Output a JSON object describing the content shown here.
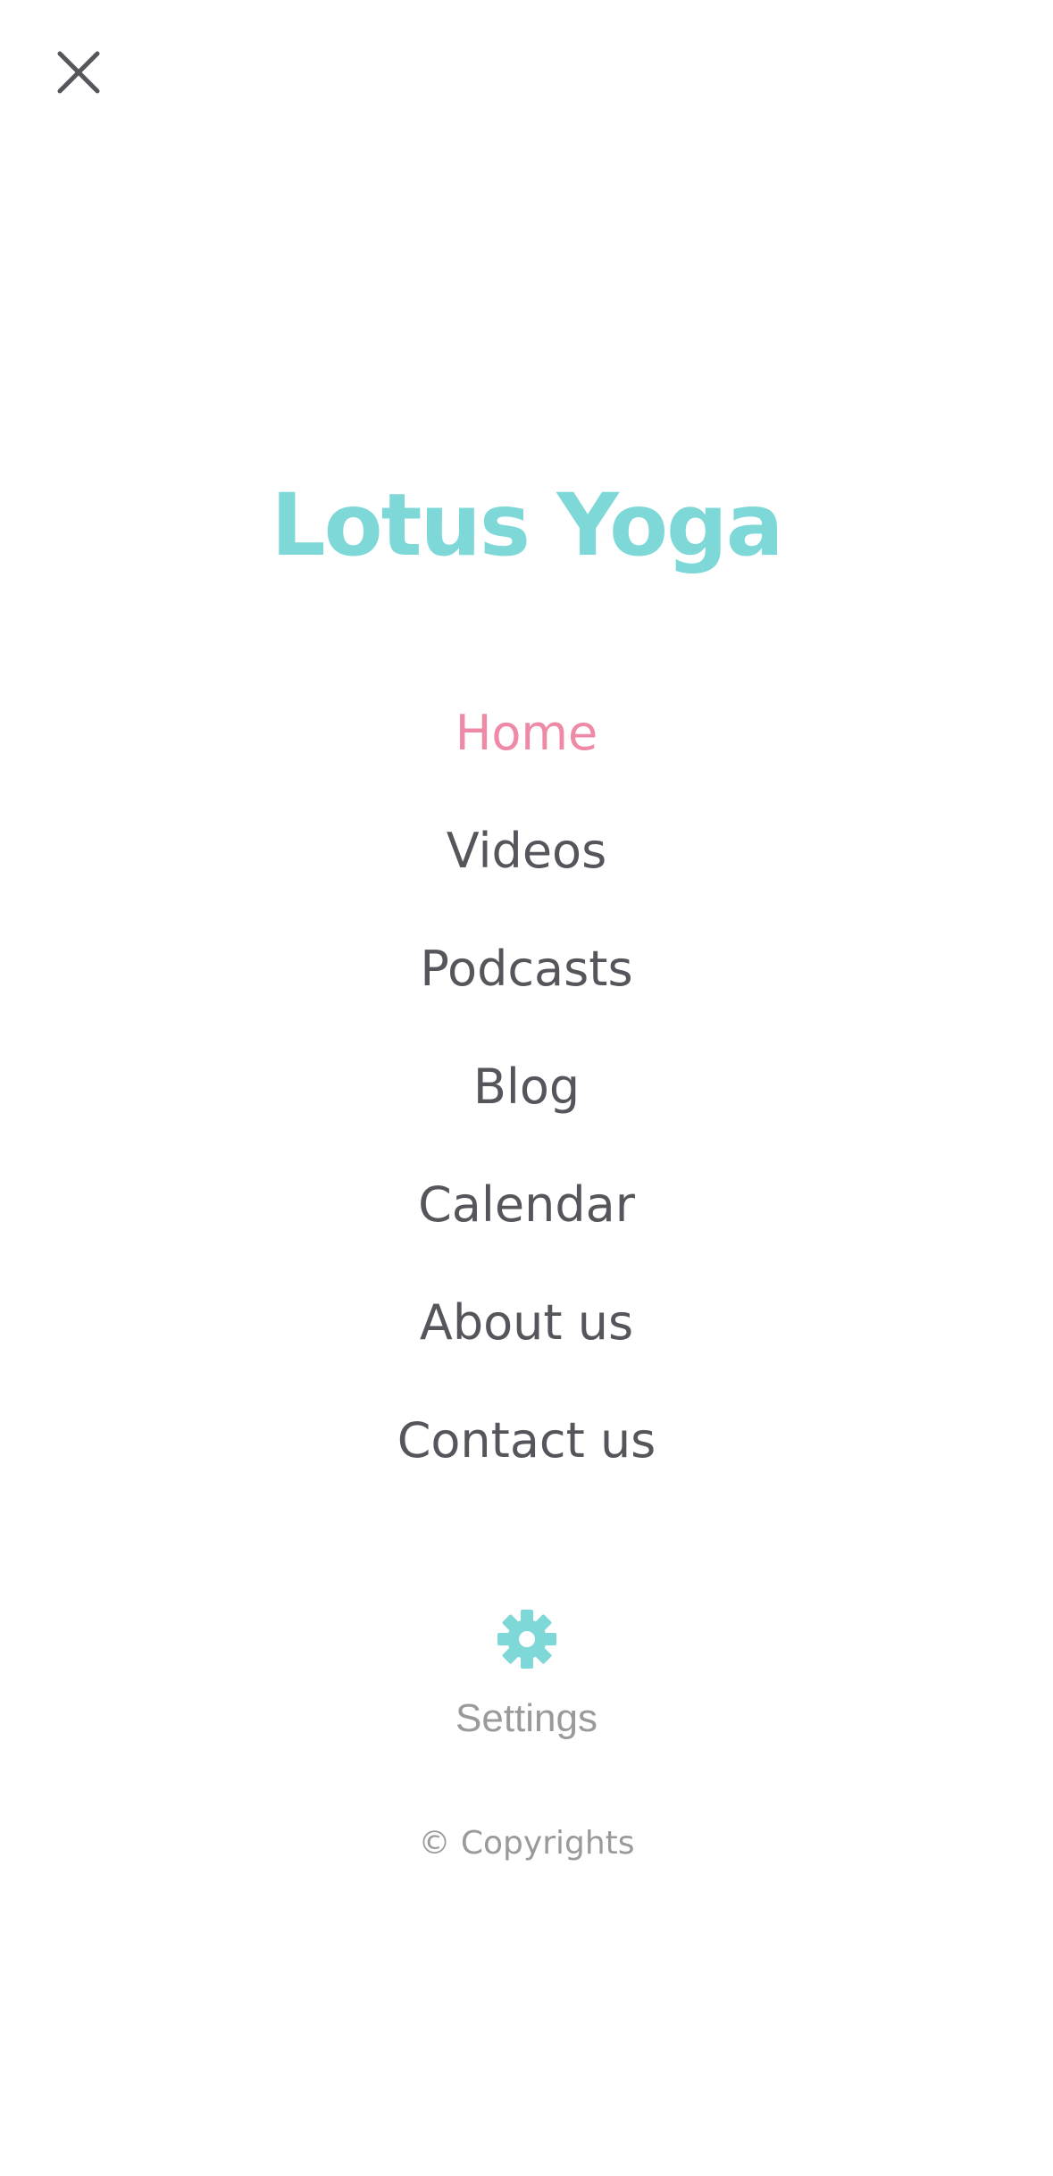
{
  "colors": {
    "accent": "#7fd8d8",
    "active": "#ee8aa6",
    "text": "#55565b",
    "muted": "#9a9a9a"
  },
  "close_icon": "close-icon",
  "brand": {
    "title": "Lotus Yoga"
  },
  "nav": {
    "items": [
      {
        "label": "Home",
        "active": true
      },
      {
        "label": "Videos",
        "active": false
      },
      {
        "label": "Podcasts",
        "active": false
      },
      {
        "label": "Blog",
        "active": false
      },
      {
        "label": "Calendar",
        "active": false
      },
      {
        "label": "About us",
        "active": false
      },
      {
        "label": "Contact us",
        "active": false
      }
    ]
  },
  "settings": {
    "icon": "gear-icon",
    "label": "Settings"
  },
  "footer": {
    "copyright": "© Copyrights"
  }
}
